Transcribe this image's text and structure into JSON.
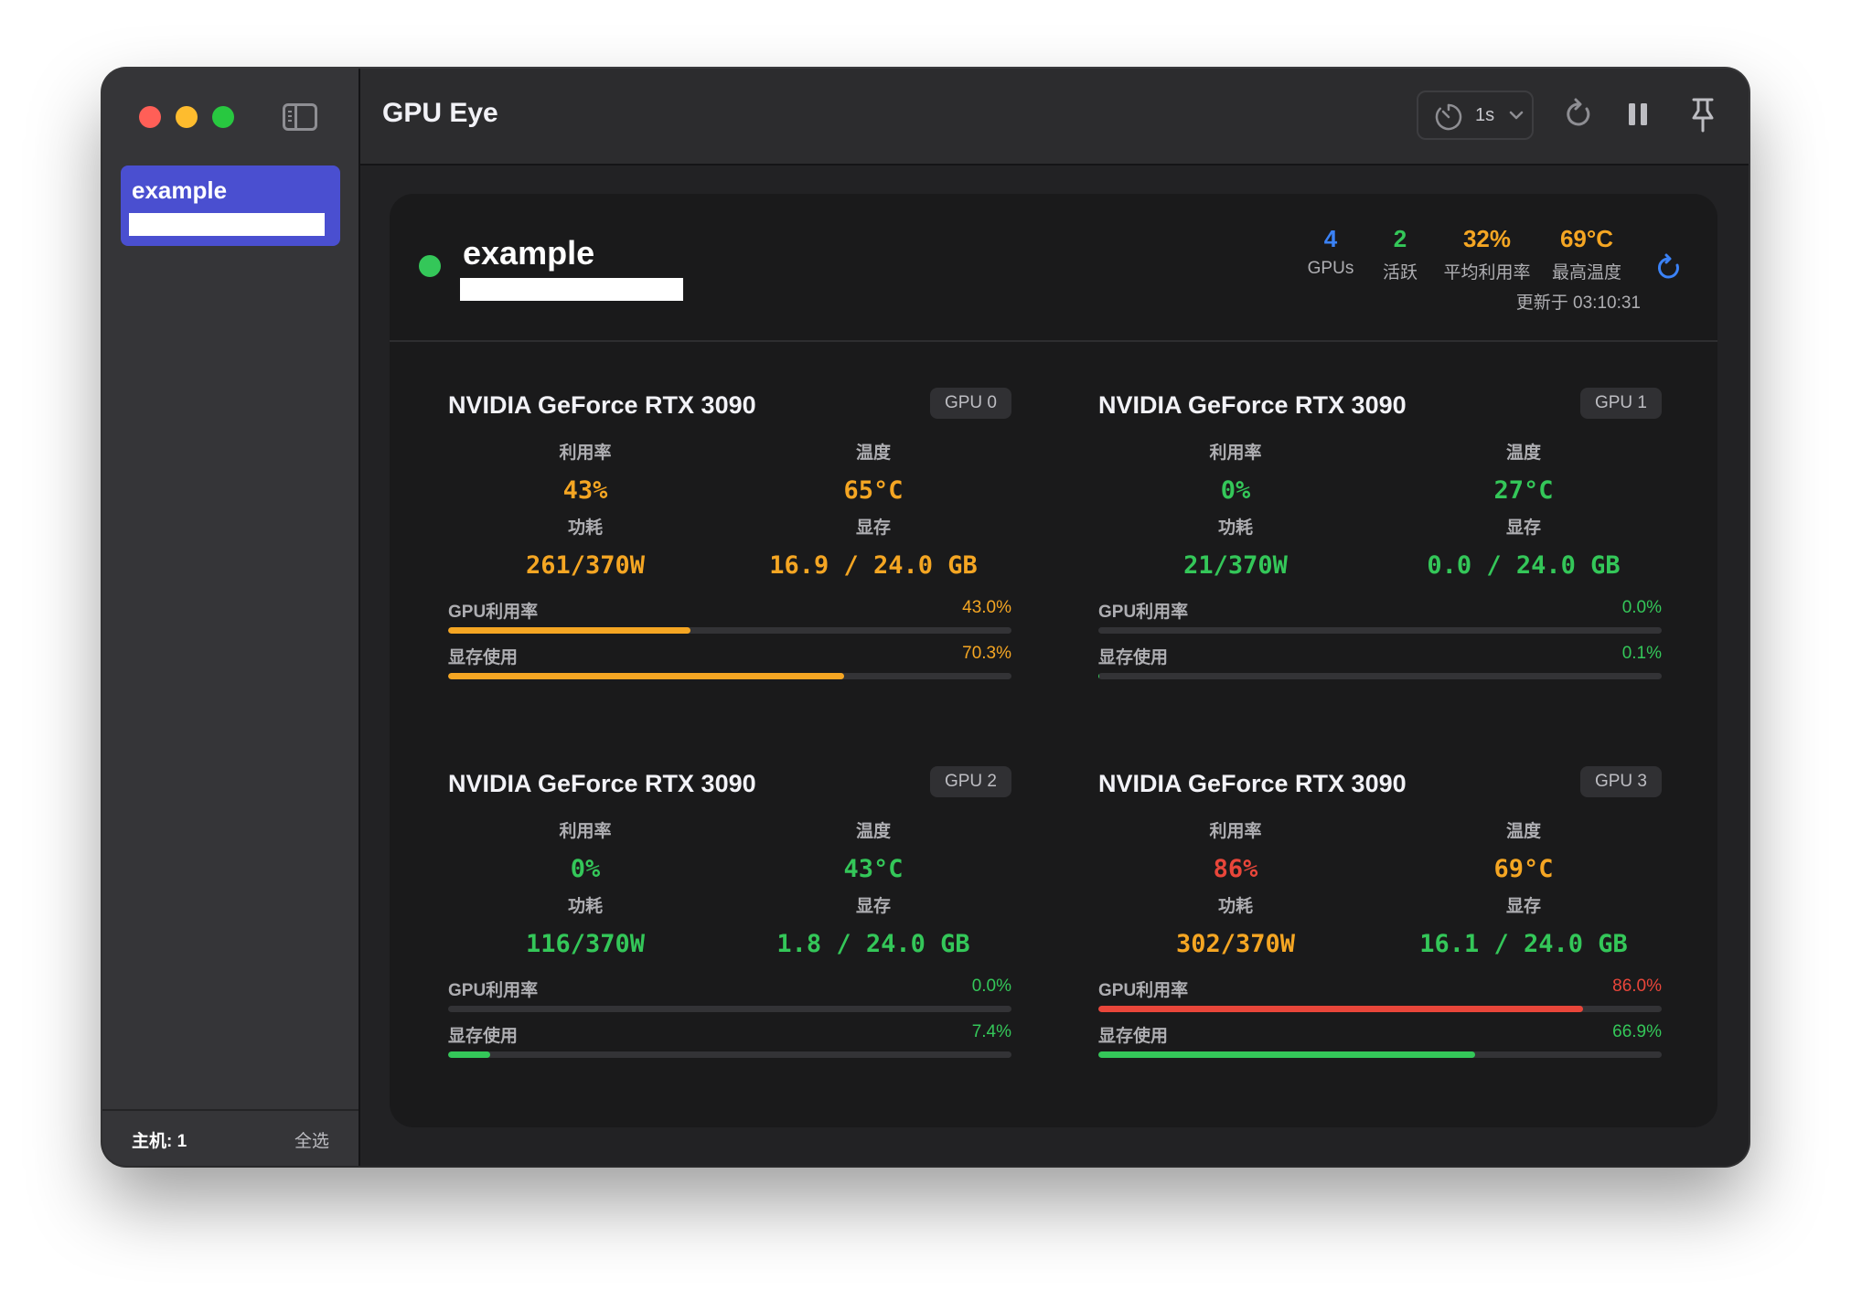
{
  "colors": {
    "blue": "#3b82f6",
    "green": "#34c759",
    "orange": "#f5a623",
    "red": "#e9463a",
    "dim": "#aeaeb2"
  },
  "window": {
    "title": "GPU Eye"
  },
  "sidebar": {
    "host_item": {
      "name": "example"
    },
    "footer": {
      "count_label": "主机: 1",
      "select_all_label": "全选"
    }
  },
  "toolbar": {
    "interval": "1s",
    "icons": [
      "timer-icon",
      "chevron-down-icon",
      "refresh-icon",
      "pause-icon",
      "pin-icon"
    ]
  },
  "host": {
    "name": "example",
    "status": "online",
    "stats": {
      "gpus": {
        "value": "4",
        "label": "GPUs",
        "color": "#3b82f6"
      },
      "active": {
        "value": "2",
        "label": "活跃",
        "color": "#34c759"
      },
      "avg_util": {
        "value": "32%",
        "label": "平均利用率",
        "color": "#f5a623"
      },
      "max_temp": {
        "value": "69°C",
        "label": "最高温度",
        "color": "#f5a623"
      }
    },
    "updated": "更新于 03:10:31"
  },
  "labels": {
    "util": "利用率",
    "temp": "温度",
    "power": "功耗",
    "memory": "显存",
    "gpu_util_bar": "GPU利用率",
    "mem_bar": "显存使用"
  },
  "gpus": [
    {
      "name": "NVIDIA GeForce RTX 3090",
      "badge": "GPU 0",
      "util": "43%",
      "util_color": "#f5a623",
      "temp": "65°C",
      "temp_color": "#f5a623",
      "power": "261/370W",
      "power_color": "#f5a623",
      "memory": "16.9 / 24.0 GB",
      "memory_color": "#f5a623",
      "util_bar": {
        "text": "43.0%",
        "fraction": 0.43,
        "color": "#f5a623"
      },
      "mem_bar": {
        "text": "70.3%",
        "fraction": 0.703,
        "color": "#f5a623"
      }
    },
    {
      "name": "NVIDIA GeForce RTX 3090",
      "badge": "GPU 1",
      "util": "0%",
      "util_color": "#34c759",
      "temp": "27°C",
      "temp_color": "#34c759",
      "power": "21/370W",
      "power_color": "#34c759",
      "memory": "0.0 / 24.0 GB",
      "memory_color": "#34c759",
      "util_bar": {
        "text": "0.0%",
        "fraction": 0.0,
        "color": "#34c759"
      },
      "mem_bar": {
        "text": "0.1%",
        "fraction": 0.001,
        "color": "#34c759"
      }
    },
    {
      "name": "NVIDIA GeForce RTX 3090",
      "badge": "GPU 2",
      "util": "0%",
      "util_color": "#34c759",
      "temp": "43°C",
      "temp_color": "#34c759",
      "power": "116/370W",
      "power_color": "#34c759",
      "memory": "1.8 / 24.0 GB",
      "memory_color": "#34c759",
      "util_bar": {
        "text": "0.0%",
        "fraction": 0.0,
        "color": "#34c759"
      },
      "mem_bar": {
        "text": "7.4%",
        "fraction": 0.074,
        "color": "#34c759"
      }
    },
    {
      "name": "NVIDIA GeForce RTX 3090",
      "badge": "GPU 3",
      "util": "86%",
      "util_color": "#e9463a",
      "temp": "69°C",
      "temp_color": "#f5a623",
      "power": "302/370W",
      "power_color": "#f5a623",
      "memory": "16.1 / 24.0 GB",
      "memory_color": "#34c759",
      "util_bar": {
        "text": "86.0%",
        "fraction": 0.86,
        "color": "#e9463a"
      },
      "mem_bar": {
        "text": "66.9%",
        "fraction": 0.669,
        "color": "#34c759"
      }
    }
  ]
}
